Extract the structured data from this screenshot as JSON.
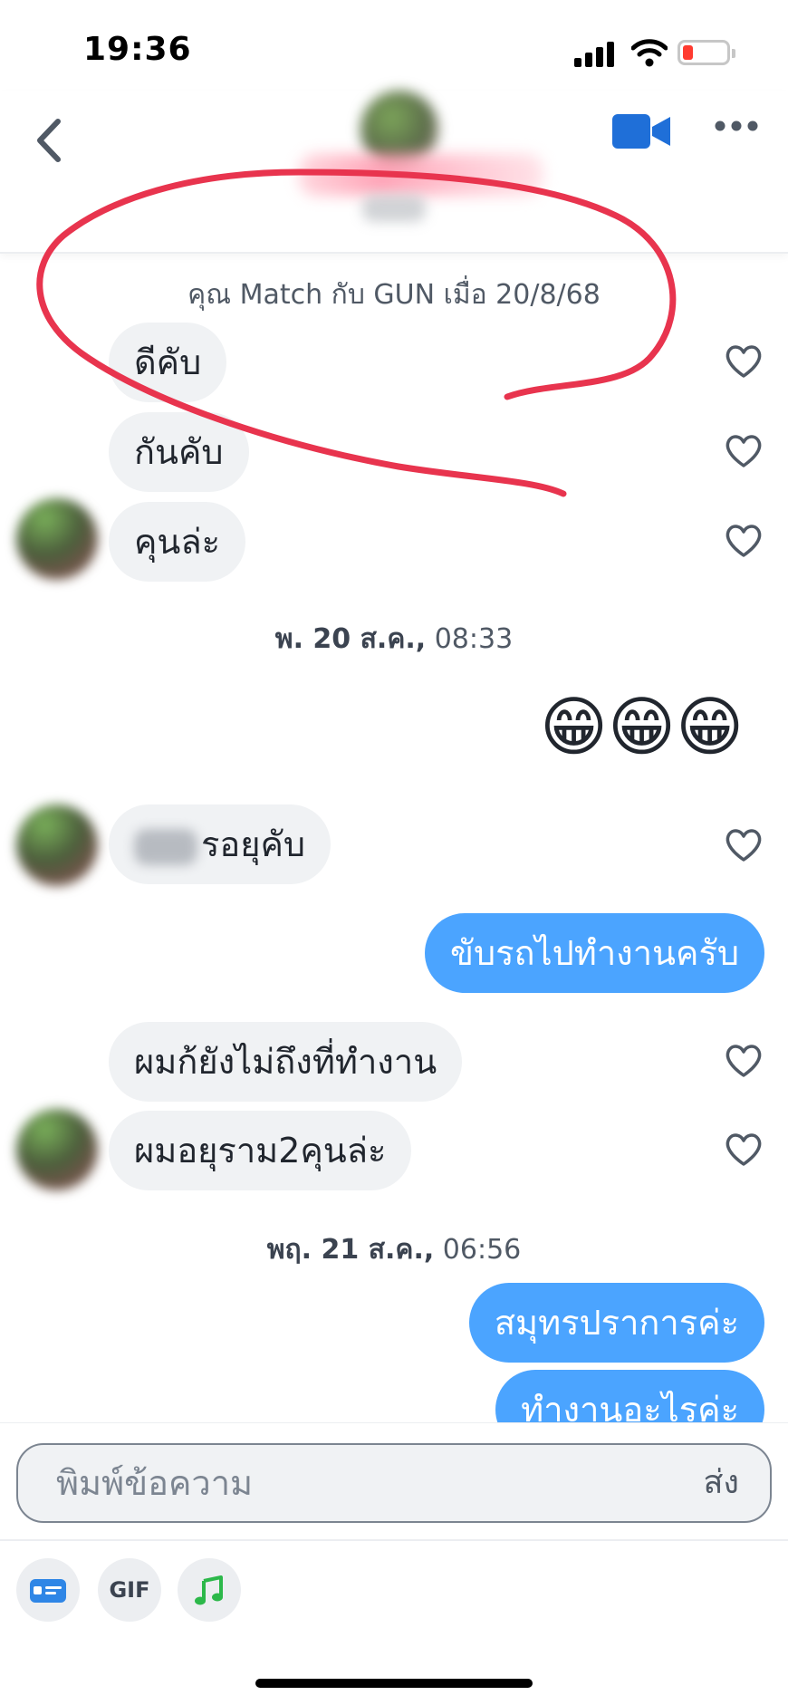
{
  "status": {
    "time": "19:36"
  },
  "header": {
    "back_icon": "chevron-left-icon",
    "video_icon": "video-camera-icon",
    "more_icon": "more-horizontal-icon",
    "accent": "#1f6fd8"
  },
  "conversation": {
    "system_message": "คุณ Match กับ GUN เมื่อ 20/8/68",
    "incoming_1": [
      "ดีคับ",
      "กันคับ",
      "คุนล่ะ"
    ],
    "date_1": {
      "bold": "พ. 20 ส.ค.,",
      "time": " 08:33"
    },
    "outgoing_emoji": "😁😁😁",
    "incoming_2": "รอยุคับ",
    "outgoing_1": "ขับรถไปทำงานครับ",
    "incoming_3": [
      "ผมก้ยังไม่ถึงที่ทำงาน",
      "ผมอยุราม2คุนล่ะ"
    ],
    "date_2": {
      "bold": "พฤ. 21 ส.ค.,",
      "time": " 06:56"
    },
    "outgoing_2": [
      "สมุทรปราการค่ะ",
      "ทำงานอะไรค่ะ"
    ],
    "bubble_in_color": "#f0f2f4",
    "bubble_out_color": "#4ba4ff",
    "annotation_color": "#e8344e"
  },
  "composer": {
    "placeholder": "พิมพ์ข้อความ",
    "send_label": "ส่ง",
    "gif_label": "GIF",
    "card_icon": "id-card-icon",
    "music_icon": "music-note-icon"
  }
}
